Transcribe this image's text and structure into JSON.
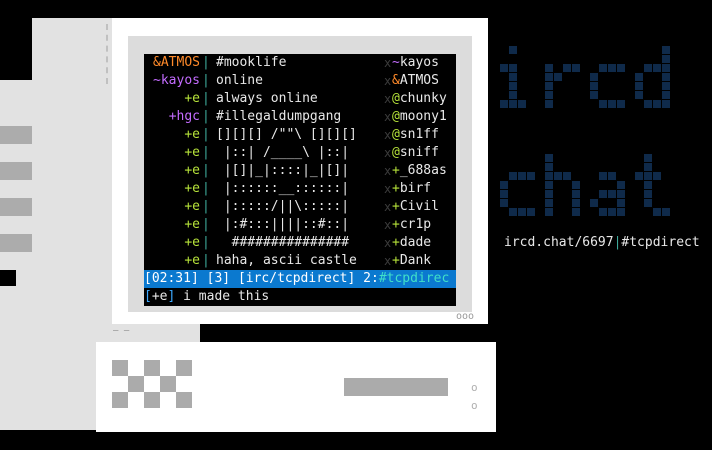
{
  "chat_lines": [
    {
      "nick": "&ATMOS",
      "nick_color": "#ff8a2a",
      "text": "#mooklife"
    },
    {
      "nick": "~kayos",
      "nick_color": "#c46cff",
      "text": "online"
    },
    {
      "nick": "+e",
      "nick_color": "#b6e23a",
      "text": "always online"
    },
    {
      "nick": "+hgc",
      "nick_color": "#c46cff",
      "text": "#illegaldumpgang"
    },
    {
      "nick": "+e",
      "nick_color": "#b6e23a",
      "text": "[][][] /\"\"\\ [][][]"
    },
    {
      "nick": "+e",
      "nick_color": "#b6e23a",
      "text": " |::| /____\\ |::|"
    },
    {
      "nick": "+e",
      "nick_color": "#b6e23a",
      "text": " |[]|_|::::|_|[]|"
    },
    {
      "nick": "+e",
      "nick_color": "#b6e23a",
      "text": " |::::::__::::::|"
    },
    {
      "nick": "+e",
      "nick_color": "#b6e23a",
      "text": " |:::::/||\\:::::|"
    },
    {
      "nick": "+e",
      "nick_color": "#b6e23a",
      "text": " |:#:::||||::#::|"
    },
    {
      "nick": "+e",
      "nick_color": "#b6e23a",
      "text": "  ###############"
    },
    {
      "nick": "+e",
      "nick_color": "#b6e23a",
      "text": "haha, ascii castle"
    }
  ],
  "separator": "|",
  "userlist_marker": "x",
  "userlist": [
    {
      "prefix": "~",
      "prefix_color": "#c46cff",
      "name": "kayos"
    },
    {
      "prefix": "&",
      "prefix_color": "#ff8a2a",
      "name": "ATMOS"
    },
    {
      "prefix": "@",
      "prefix_color": "#b6e23a",
      "name": "chunky"
    },
    {
      "prefix": "@",
      "prefix_color": "#b6e23a",
      "name": "moony1"
    },
    {
      "prefix": "@",
      "prefix_color": "#b6e23a",
      "name": "sn1ff"
    },
    {
      "prefix": "@",
      "prefix_color": "#b6e23a",
      "name": "sniff"
    },
    {
      "prefix": "+",
      "prefix_color": "#b6e23a",
      "name": "_688as"
    },
    {
      "prefix": "+",
      "prefix_color": "#b6e23a",
      "name": "birf"
    },
    {
      "prefix": "+",
      "prefix_color": "#b6e23a",
      "name": "Civil"
    },
    {
      "prefix": "+",
      "prefix_color": "#b6e23a",
      "name": "cr1p"
    },
    {
      "prefix": "+",
      "prefix_color": "#b6e23a",
      "name": "dade"
    },
    {
      "prefix": "+",
      "prefix_color": "#b6e23a",
      "name": "Dank"
    }
  ],
  "statusbar": {
    "time": "[02:31]",
    "window": "[3]",
    "network": "[irc/tcpdirect",
    "network_close": "]",
    "win2": "2:",
    "channel": "#tcpdirec"
  },
  "input": {
    "open": "[",
    "nick": "+e",
    "close": "]",
    "text": "i made this"
  },
  "monitor": {
    "leds": "ooo",
    "ticks": "‒ ‒"
  },
  "logo": {
    "line1": "ircd",
    "line2": "chat",
    "color": "#0f2a4a"
  },
  "caption": {
    "host": "ircd.chat/6697",
    "bar": "|",
    "channel": "#tcpdirect",
    "bar_color": "#3da99a"
  },
  "case": {
    "knob": "o"
  }
}
